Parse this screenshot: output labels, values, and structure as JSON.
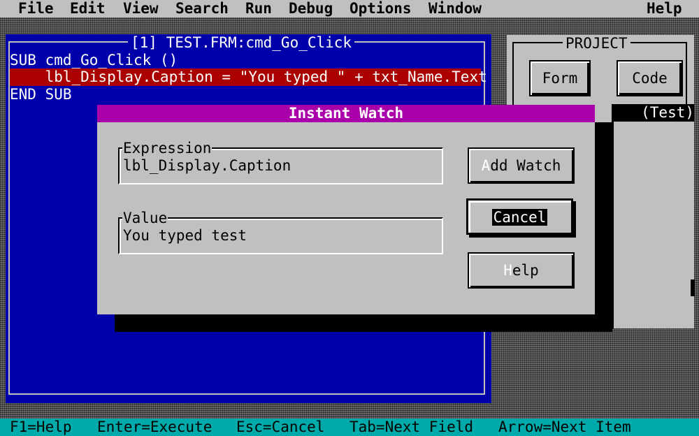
{
  "menu": {
    "file": "File",
    "edit": "Edit",
    "view": "View",
    "search": "Search",
    "run": "Run",
    "debug": "Debug",
    "options": "Options",
    "window": "Window",
    "help": "Help"
  },
  "code_window": {
    "title": "[1] TEST.FRM:cmd_Go_Click",
    "lines": [
      "SUB cmd_Go_Click ()",
      "    lbl_Display.Caption = \"You typed \" + txt_Name.Text",
      "END SUB"
    ]
  },
  "project_window": {
    "title": "PROJECT",
    "form_button": "Form",
    "code_button": "Code",
    "list_header": "(Test)"
  },
  "dialog": {
    "title": "Instant Watch",
    "expression_label": "Expression",
    "expression_value": "lbl_Display.Caption",
    "value_label": "Value",
    "value_value": "You typed test",
    "add_watch_hotkey": "A",
    "add_watch_rest": "dd Watch",
    "cancel_label": "Cancel",
    "help_hotkey": "H",
    "help_rest": "elp"
  },
  "statusbar": {
    "f1": "F1=Help",
    "enter": "Enter=Execute",
    "esc": "Esc=Cancel",
    "tab": "Tab=Next Field",
    "arrow": "Arrow=Next Item"
  },
  "colors": {
    "editor_bg": "#0000aa",
    "highlight": "#aa0000",
    "dialog_title": "#aa00aa",
    "statusbar": "#00aaaa",
    "chrome": "#c0c0c0"
  }
}
